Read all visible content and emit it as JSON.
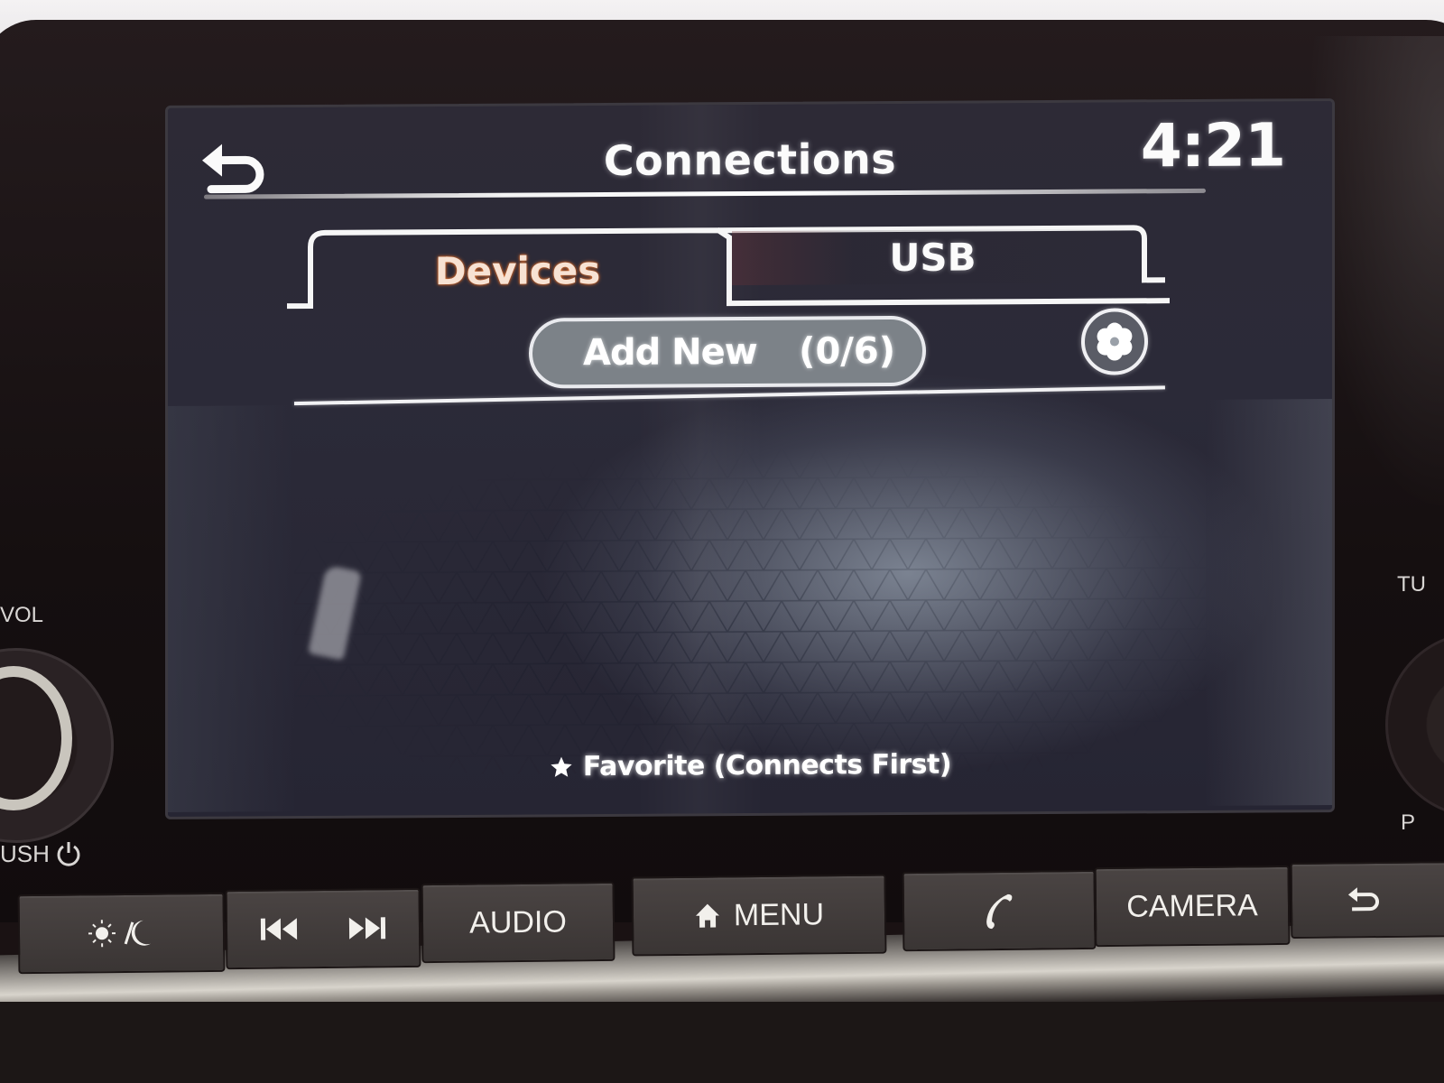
{
  "screen": {
    "title": "Connections",
    "clock": "4:21",
    "back_icon": "back-arrow-icon",
    "tabs": [
      {
        "label": "Devices",
        "active": true,
        "accent_color": "#e0712f"
      },
      {
        "label": "USB",
        "active": false
      }
    ],
    "add_new": {
      "label": "Add New",
      "count": "(0/6)"
    },
    "settings_icon": "gear-icon",
    "devices": [],
    "legend": {
      "icon": "star-icon",
      "text": "Favorite (Connects First)"
    }
  },
  "controls": {
    "left_knob": {
      "top_label": "VOL",
      "bottom_label": "USH",
      "bottom_icon": "power-icon"
    },
    "right_knob": {
      "top_label": "TU",
      "bottom_label": "P"
    }
  },
  "hardware_buttons": [
    {
      "icon": "day-night-icon",
      "label": ""
    },
    {
      "icon": "skip-back-icon",
      "label": ""
    },
    {
      "icon": "skip-forward-icon",
      "label": ""
    },
    {
      "icon": "",
      "label": "AUDIO"
    },
    {
      "icon": "home-icon",
      "label": "MENU"
    },
    {
      "icon": "phone-icon",
      "label": ""
    },
    {
      "icon": "",
      "label": "CAMERA"
    },
    {
      "icon": "back-arrow-icon",
      "label": ""
    }
  ]
}
